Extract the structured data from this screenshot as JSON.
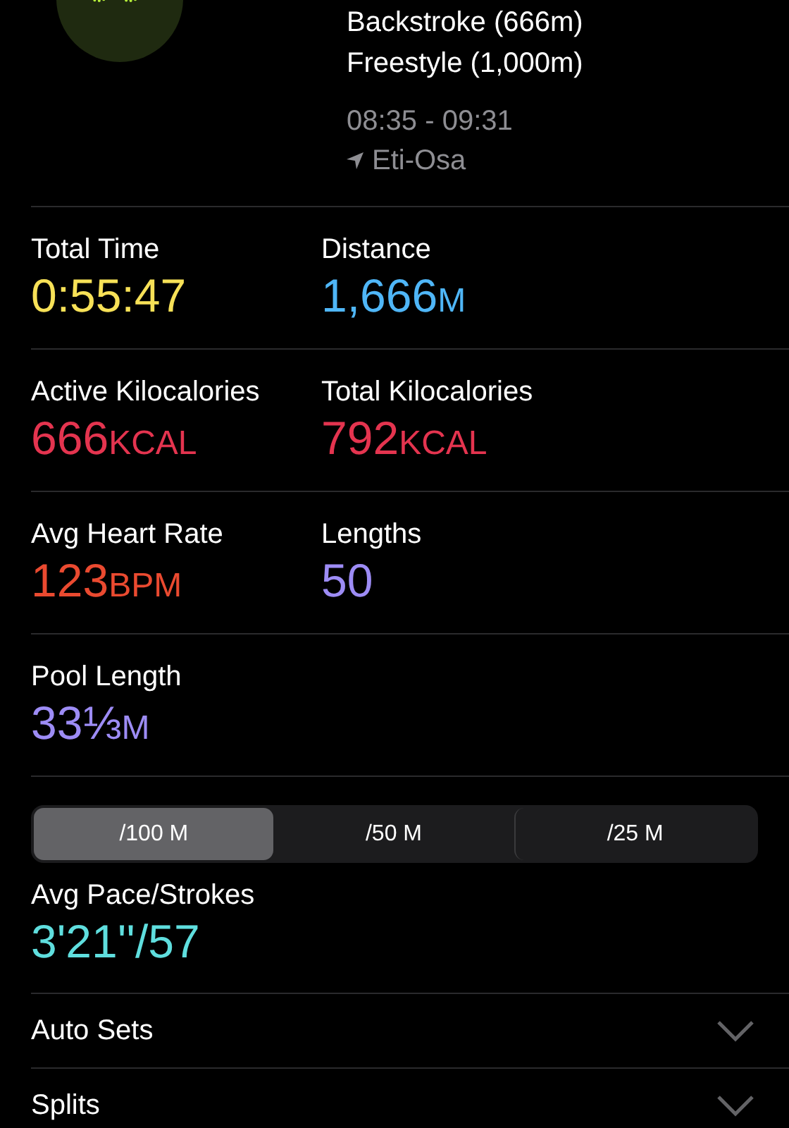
{
  "workout": {
    "strokes": [
      "Backstroke (666m)",
      "Freestyle (1,000m)"
    ],
    "time_range": "08:35 - 09:31",
    "location": "Eti-Osa"
  },
  "metric_rows": [
    [
      {
        "label": "Total Time",
        "value": "0:55:47",
        "color": "#f7e157"
      },
      {
        "label": "Distance",
        "value": "1,666",
        "unit": "M",
        "color": "#4fb6f7"
      }
    ],
    [
      {
        "label": "Active Kilocalories",
        "value": "666",
        "unit": "KCAL",
        "color": "#e4344f"
      },
      {
        "label": "Total Kilocalories",
        "value": "792",
        "unit": "KCAL",
        "color": "#e4344f"
      }
    ],
    [
      {
        "label": "Avg Heart Rate",
        "value": "123",
        "unit": "BPM",
        "color": "#ea4a30"
      },
      {
        "label": "Lengths",
        "value": "50",
        "color": "#9d8cf5"
      }
    ],
    [
      {
        "label": "Pool Length",
        "value": "33⅓",
        "unit": "M",
        "color": "#9d8cf5"
      }
    ]
  ],
  "pace_segments": [
    {
      "label": "/100 M",
      "selected": true
    },
    {
      "label": "/50 M",
      "selected": false
    },
    {
      "label": "/25 M",
      "selected": false
    }
  ],
  "pace": {
    "label": "Avg Pace/Strokes",
    "value": "3'21''/57",
    "color": "#5fdede"
  },
  "sections": [
    {
      "label": "Auto Sets",
      "expanded": false
    },
    {
      "label": "Splits",
      "expanded": false
    }
  ]
}
